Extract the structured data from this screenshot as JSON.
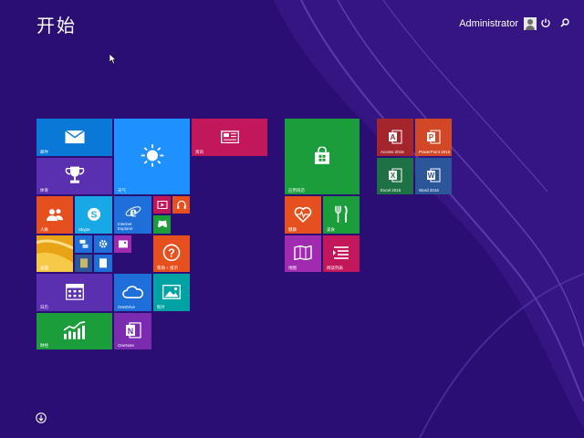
{
  "header": {
    "title": "开始",
    "user_name": "Administrator",
    "power_icon": "power-icon",
    "search_icon": "search-icon"
  },
  "tiles": {
    "mail": {
      "label": "邮件",
      "color": "#0a78d7",
      "icon": "mail-icon"
    },
    "weather": {
      "label": "天气",
      "color": "#1e90ff",
      "icon": "sun-icon"
    },
    "news": {
      "label": "资讯",
      "color": "#c2185b",
      "icon": "newspaper-icon"
    },
    "trophy": {
      "label": "体育",
      "color": "#5a2fb0",
      "icon": "trophy-icon"
    },
    "people": {
      "label": "人脉",
      "color": "#e6501e",
      "icon": "people-icon"
    },
    "skype": {
      "label": "Skype",
      "color": "#19a8e6",
      "icon": "skype-icon"
    },
    "ie": {
      "label": "Internet Explorer",
      "color": "#1e6fd9",
      "icon": "ie-icon"
    },
    "video": {
      "color": "#c2185b",
      "icon": "video-icon"
    },
    "music": {
      "color": "#e6501e",
      "icon": "headphones-icon"
    },
    "games": {
      "color": "#1c9d3c",
      "icon": "gamepad-icon"
    },
    "desktop": {
      "label": "桌面",
      "color": "#e8a317",
      "icon": "desktop-icon"
    },
    "help": {
      "label": "帮助 + 提示",
      "color": "#e6501e",
      "icon": "question-icon"
    },
    "calendar": {
      "label": "日历",
      "color": "#5a2fb0",
      "icon": "calendar-icon"
    },
    "onedrive": {
      "label": "OneDrive",
      "color": "#1e6fd9",
      "icon": "cloud-icon"
    },
    "photos": {
      "label": "照片",
      "color": "#00a3a3",
      "icon": "photo-icon"
    },
    "finance": {
      "label": "财经",
      "color": "#1c9d3c",
      "icon": "chart-icon"
    },
    "onenote": {
      "label": "OneNote",
      "color": "#7a2bb0",
      "icon": "onenote-icon"
    },
    "store": {
      "label": "应用商店",
      "color": "#1c9d3c",
      "icon": "store-icon"
    },
    "health": {
      "label": "健康",
      "color": "#e6501e",
      "icon": "heart-icon"
    },
    "food": {
      "label": "美食",
      "color": "#1c9d3c",
      "icon": "fork-knife-icon"
    },
    "maps": {
      "label": "地图",
      "color": "#a02ab0",
      "icon": "map-icon"
    },
    "reading": {
      "label": "阅读列表",
      "color": "#c2185b",
      "icon": "reading-list-icon"
    },
    "access": {
      "label": "Access 2016",
      "color": "#a4262c",
      "icon": "access-icon"
    },
    "powerpoint": {
      "label": "PowerPoint 2016",
      "color": "#d24726",
      "icon": "powerpoint-icon"
    },
    "excel": {
      "label": "Excel 2016",
      "color": "#1e7145",
      "icon": "excel-icon"
    },
    "word": {
      "label": "Word 2016",
      "color": "#2b579a",
      "icon": "word-icon"
    }
  },
  "footer": {
    "all_apps_icon": "down-arrow-icon"
  }
}
